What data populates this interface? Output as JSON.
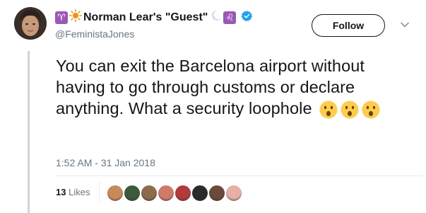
{
  "tweet": {
    "display_name": "Norman Lear's \"Guest\"",
    "handle": "@FeministaJones",
    "follow_label": "Follow",
    "text": "You can exit the Barcelona airport without having to go through customs or declare anything. What a security loophole",
    "timestamp": "1:52 AM - 31 Jan 2018",
    "likes_count": "13",
    "likes_label": "Likes",
    "name_emoji": {
      "aries": "♈",
      "sun": "☀",
      "moon": "🌙",
      "leo": "♌"
    },
    "text_emoji": [
      "😮",
      "😮",
      "😮"
    ]
  },
  "icons": {
    "verified": "verified-badge-icon",
    "caret": "chevron-down-icon"
  },
  "colors": {
    "brand_blue": "#1da1f2",
    "muted": "#657786",
    "text": "#14171a",
    "zodiac_purple": "#9b59b6",
    "sun_orange": "#f4900c",
    "emoji_yellow": "#ffcc4d"
  },
  "likers": [
    {
      "avatar": "liker-1",
      "color": "#c98a5a"
    },
    {
      "avatar": "liker-2",
      "color": "#3d5a3a"
    },
    {
      "avatar": "liker-3",
      "color": "#8e6b4a"
    },
    {
      "avatar": "liker-4",
      "color": "#d07a6a"
    },
    {
      "avatar": "liker-5",
      "color": "#b33a3a"
    },
    {
      "avatar": "liker-6",
      "color": "#2b2b2b"
    },
    {
      "avatar": "liker-7",
      "color": "#6a4a3a"
    },
    {
      "avatar": "liker-8",
      "color": "#e4b0a8"
    }
  ]
}
